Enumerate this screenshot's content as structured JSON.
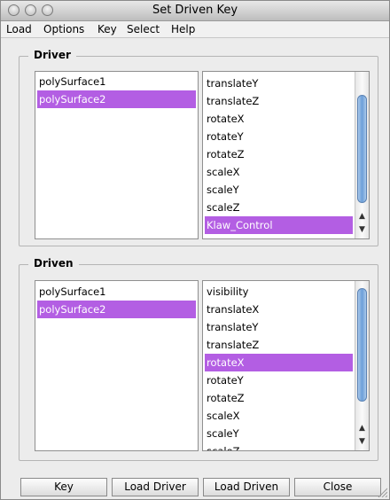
{
  "window": {
    "title": "Set Driven Key"
  },
  "menu": [
    "Load",
    "Options",
    "Key",
    "Select",
    "Help"
  ],
  "driver": {
    "legend": "Driver",
    "objects": [
      "polySurface1",
      "polySurface2"
    ],
    "objects_selected": 1,
    "attributes": [
      "translateY",
      "translateZ",
      "rotateX",
      "rotateY",
      "rotateZ",
      "scaleX",
      "scaleY",
      "scaleZ",
      "Klaw_Control"
    ],
    "attributes_selected": 8
  },
  "driven": {
    "legend": "Driven",
    "objects": [
      "polySurface1",
      "polySurface2"
    ],
    "objects_selected": 1,
    "attributes": [
      "visibility",
      "translateX",
      "translateY",
      "translateZ",
      "rotateX",
      "rotateY",
      "rotateZ",
      "scaleX",
      "scaleY",
      "scaleZ"
    ],
    "attributes_selected": 4
  },
  "buttons": {
    "key": "Key",
    "load_driver": "Load Driver",
    "load_driven": "Load Driven",
    "close": "Close"
  },
  "colors": {
    "selection": "#b35ee3",
    "scroll_thumb": "#6c9fd9"
  },
  "icons": {
    "close": "close-icon",
    "minimize": "minimize-icon",
    "zoom": "zoom-icon",
    "resize": "resize-grip-icon"
  }
}
